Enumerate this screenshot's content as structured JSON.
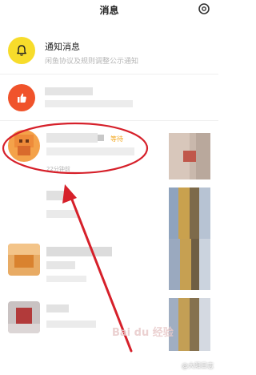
{
  "header": {
    "title": "消息",
    "settings_icon": "gear-icon"
  },
  "system_notice": {
    "title": "通知消息",
    "subtitle": "闲鱼协议及规则调整公示通知",
    "icon": "bell-icon",
    "icon_color": "#f7dc2b"
  },
  "like_notice": {
    "icon": "thumbs-up-icon",
    "icon_color": "#f0532b"
  },
  "highlighted_message": {
    "tag": "等待",
    "time": "22分钟前",
    "annotation_color": "#d6202a"
  },
  "watermark": {
    "logo_text": "Bai du 经验",
    "text": "@大阳日志"
  }
}
